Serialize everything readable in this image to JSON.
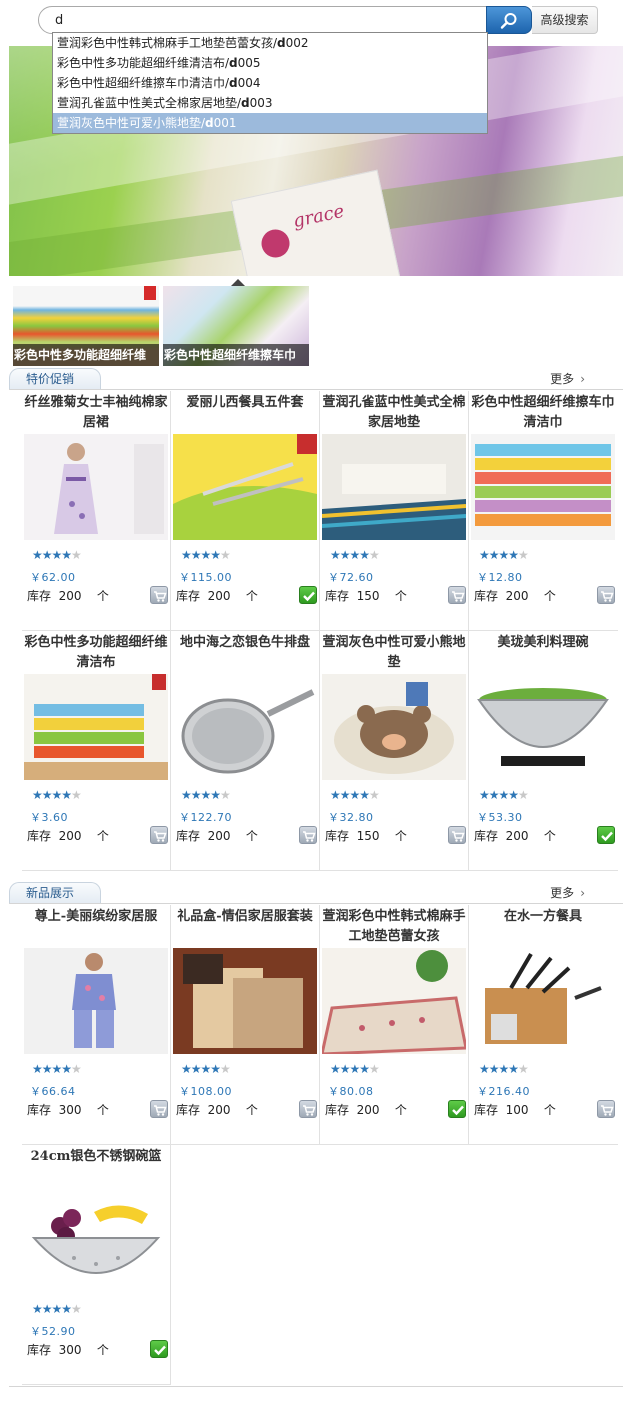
{
  "search": {
    "value": "d",
    "button_icon": "search-icon",
    "advanced_label": "高级搜索"
  },
  "suggestions": [
    {
      "prefix": "萱润彩色中性韩式棉麻手工地垫芭蕾女孩/",
      "key": "d",
      "suffix": "002",
      "active": false
    },
    {
      "prefix": "彩色中性多功能超细纤维清洁布/",
      "key": "d",
      "suffix": "005",
      "active": false
    },
    {
      "prefix": "彩色中性超细纤维擦车巾清洁巾/",
      "key": "d",
      "suffix": "004",
      "active": false
    },
    {
      "prefix": "萱润孔雀蓝中性美式全棉家居地垫/",
      "key": "d",
      "suffix": "003",
      "active": false
    },
    {
      "prefix": "萱润灰色中性可爱小熊地垫/",
      "key": "d",
      "suffix": "001",
      "active": true
    }
  ],
  "banner": {
    "logo_text": "grace",
    "thumbs": [
      {
        "caption": "彩色中性多功能超细纤维"
      },
      {
        "caption": "彩色中性超细纤维擦车巾"
      }
    ]
  },
  "sections": {
    "promo": {
      "title": "特价促销",
      "more": "更多"
    },
    "newest": {
      "title": "新品展示",
      "more": "更多"
    }
  },
  "labels": {
    "stock": "库存",
    "unit": "个"
  },
  "promo_products": [
    {
      "title": "纤丝雅菊女士丰袖纯棉家居裙",
      "price": "￥62.00",
      "stock": "200",
      "rating": 4,
      "cart": "gray",
      "img": "dress"
    },
    {
      "title": "爱丽儿西餐具五件套",
      "price": "￥115.00",
      "stock": "200",
      "rating": 4,
      "cart": "green",
      "img": "cutlery"
    },
    {
      "title": "萱润孔雀蓝中性美式全棉家居地垫",
      "price": "￥72.60",
      "stock": "150",
      "rating": 4,
      "cart": "gray",
      "img": "rug-blue"
    },
    {
      "title": "彩色中性超细纤维擦车巾清洁巾",
      "price": "￥12.80",
      "stock": "200",
      "rating": 4,
      "cart": "gray",
      "img": "towels"
    },
    {
      "title": "彩色中性多功能超细纤维清洁布",
      "price": "￥3.60",
      "stock": "200",
      "rating": 4,
      "cart": "gray",
      "img": "cloths"
    },
    {
      "title": "地中海之恋银色牛排盘",
      "price": "￥122.70",
      "stock": "200",
      "rating": 4,
      "cart": "gray",
      "img": "pan"
    },
    {
      "title": "萱润灰色中性可爱小熊地垫",
      "price": "￥32.80",
      "stock": "150",
      "rating": 4,
      "cart": "gray",
      "img": "bear-rug"
    },
    {
      "title": "美珑美利料理碗",
      "price": "￥53.30",
      "stock": "200",
      "rating": 4,
      "cart": "green",
      "img": "bowl"
    }
  ],
  "new_products": [
    {
      "title": "尊上-美丽缤纷家居服",
      "price": "￥66.64",
      "stock": "300",
      "rating": 4,
      "cart": "gray",
      "img": "pajama"
    },
    {
      "title": "礼品盒-情侣家居服套装",
      "price": "￥108.00",
      "stock": "200",
      "rating": 4,
      "cart": "gray",
      "img": "robe"
    },
    {
      "title": "萱润彩色中性韩式棉麻手工地垫芭蕾女孩",
      "price": "￥80.08",
      "stock": "200",
      "rating": 4,
      "cart": "green",
      "img": "rug-floral"
    },
    {
      "title": "在水一方餐具",
      "price": "￥216.40",
      "stock": "100",
      "rating": 4,
      "cart": "gray",
      "img": "knives"
    },
    {
      "title": "24cm银色不锈钢碗篮",
      "price": "￥52.90",
      "stock": "300",
      "rating": 4,
      "cart": "green",
      "img": "colander"
    }
  ],
  "colors": {
    "accent": "#2e77b6",
    "highlight": "#9cbadc",
    "cart_green": "#3aa52c"
  }
}
